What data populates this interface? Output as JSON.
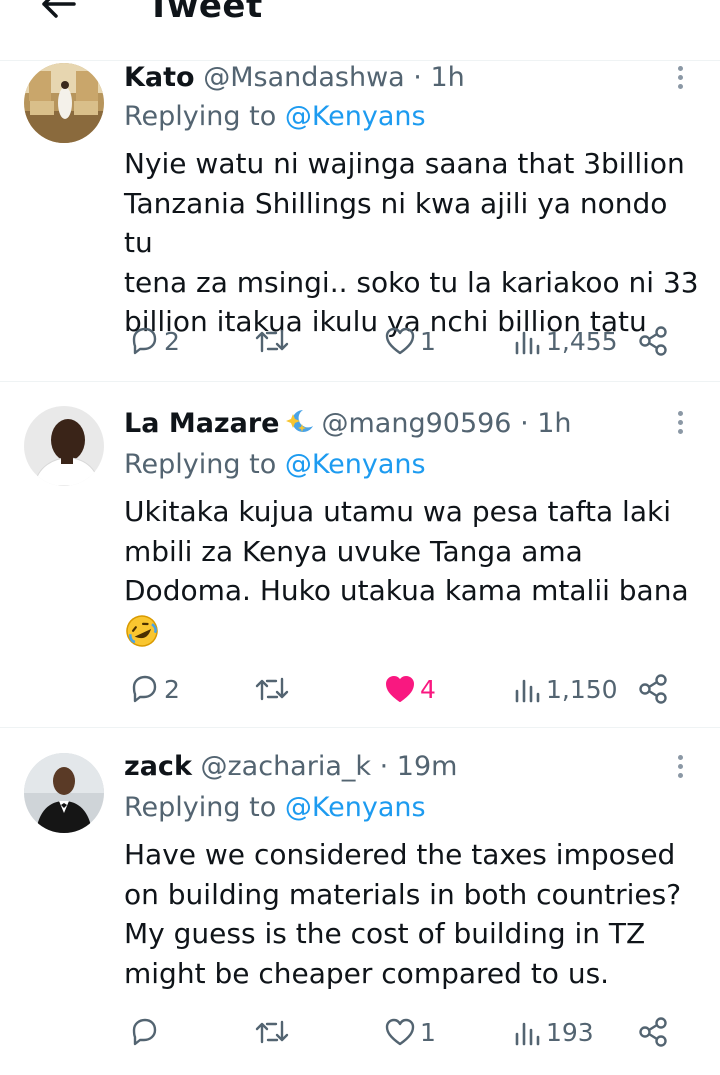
{
  "header": {
    "title": "Tweet"
  },
  "tweets": [
    {
      "name": "Kato",
      "handle": "@Msandashwa",
      "time": "1h",
      "replying_prefix": "Replying to",
      "replying_to": "@Kenyans",
      "lines": [
        "Nyie watu ni wajinga saana that 3billion",
        "Tanzania Shillings ni kwa ajili ya nondo tu",
        "tena za msingi.. soko tu la kariakoo ni 33",
        "billion itakua ikulu ya nchi billion tatu"
      ],
      "replies": "2",
      "retweets": "",
      "likes": "1",
      "views": "1,455",
      "liked": false
    },
    {
      "name": "La Mazare",
      "handle": "@mang90596",
      "time": "1h",
      "replying_prefix": "Replying to",
      "replying_to": "@Kenyans",
      "lines": [
        "Ukitaka kujua utamu wa pesa tafta laki",
        "mbili za Kenya uvuke Tanga ama",
        "Dodoma. Huko utakua kama mtalii bana"
      ],
      "replies": "2",
      "retweets": "",
      "likes": "4",
      "views": "1,150",
      "liked": true
    },
    {
      "name": "zack",
      "handle": "@zacharia_k",
      "time": "19m",
      "replying_prefix": "Replying to",
      "replying_to": "@Kenyans",
      "lines": [
        "Have we considered the taxes imposed",
        "on building materials in both countries?",
        "My guess is the cost of building in TZ",
        "might be cheaper compared to us."
      ],
      "replies": "",
      "retweets": "",
      "likes": "1",
      "views": "193",
      "liked": false
    }
  ],
  "colors": {
    "link": "#1d9bf0",
    "secondary": "#536471",
    "like": "#f91880"
  },
  "icons": {
    "back": "arrow-left-icon",
    "more": "more-vertical-icon",
    "reply": "reply-icon",
    "retweet": "retweet-icon",
    "like": "heart-icon",
    "views": "views-icon",
    "share": "share-icon"
  }
}
